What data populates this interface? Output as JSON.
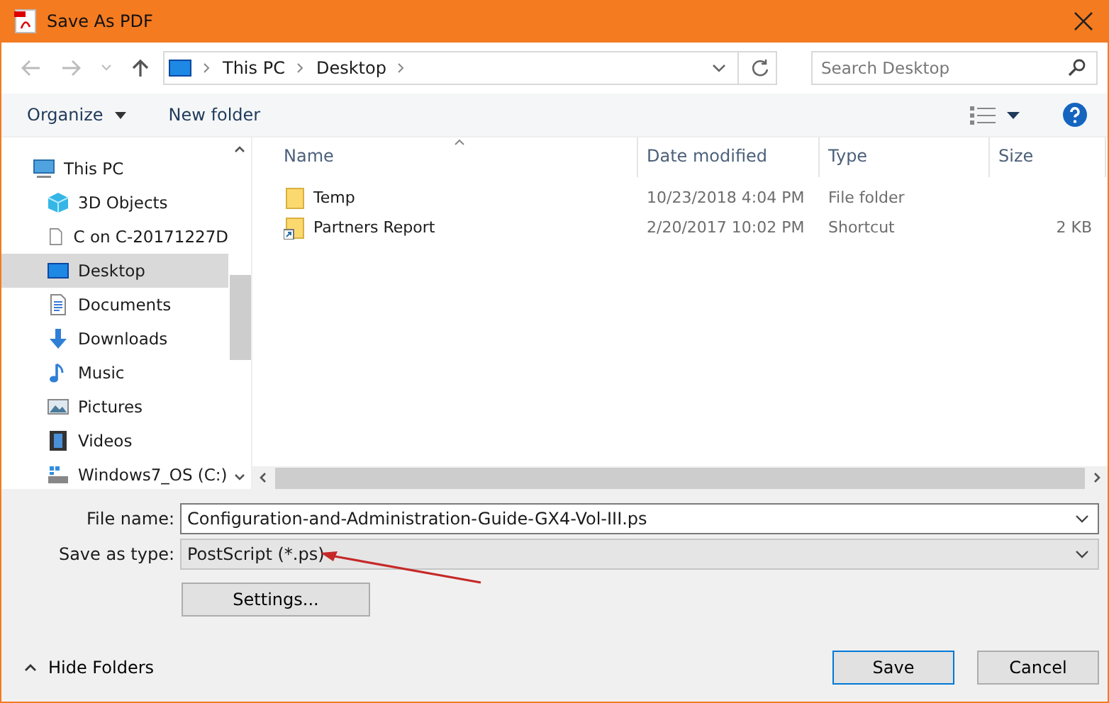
{
  "window": {
    "title": "Save As PDF"
  },
  "address": {
    "crumbs": [
      "This PC",
      "Desktop"
    ]
  },
  "search": {
    "placeholder": "Search Desktop"
  },
  "toolbar": {
    "organize": "Organize",
    "new_folder": "New folder"
  },
  "sidebar": {
    "items": [
      {
        "label": "This PC",
        "kind": "pc",
        "selected": false,
        "children": [
          {
            "label": "3D Objects",
            "kind": "cube",
            "selected": false
          },
          {
            "label": "C on C-20171227D",
            "kind": "file",
            "selected": false
          },
          {
            "label": "Desktop",
            "kind": "desktop",
            "selected": true
          },
          {
            "label": "Documents",
            "kind": "doc",
            "selected": false
          },
          {
            "label": "Downloads",
            "kind": "download",
            "selected": false
          },
          {
            "label": "Music",
            "kind": "music",
            "selected": false
          },
          {
            "label": "Pictures",
            "kind": "pictures",
            "selected": false
          },
          {
            "label": "Videos",
            "kind": "videos",
            "selected": false
          },
          {
            "label": "Windows7_OS (C:)",
            "kind": "drive",
            "selected": false
          }
        ]
      }
    ]
  },
  "table": {
    "columns": [
      "Name",
      "Date modified",
      "Type",
      "Size"
    ],
    "rows": [
      {
        "kind": "folder",
        "name": "Temp",
        "date": "10/23/2018 4:04 PM",
        "type": "File folder",
        "size": ""
      },
      {
        "kind": "shortcut",
        "name": "Partners Report",
        "date": "2/20/2017 10:02 PM",
        "type": "Shortcut",
        "size": "2 KB"
      }
    ]
  },
  "form": {
    "file_name_label": "File name:",
    "file_name": "Configuration-and-Administration-Guide-GX4-Vol-III.ps",
    "type_label": "Save as type:",
    "type_value": "PostScript (*.ps)",
    "settings": "Settings..."
  },
  "footer": {
    "hide_folders": "Hide Folders",
    "buttons": [
      "Save",
      "Cancel"
    ]
  }
}
